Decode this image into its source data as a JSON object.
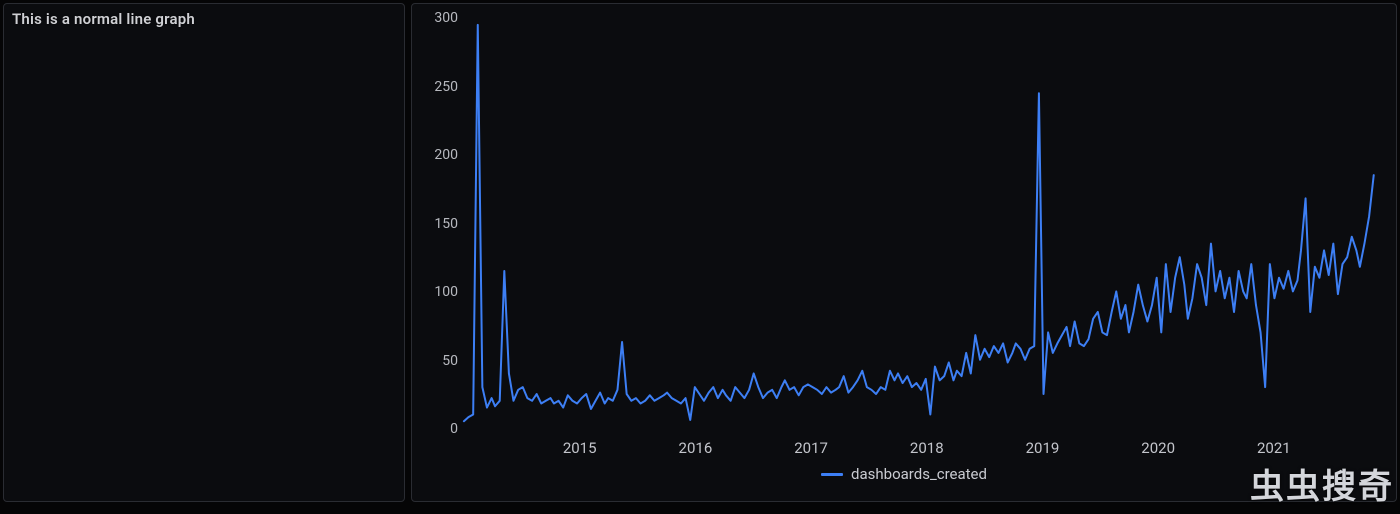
{
  "left_panel": {
    "title": "This is a normal line graph"
  },
  "watermark": "虫虫搜奇",
  "chart_data": {
    "type": "line",
    "title": "",
    "xlabel": "",
    "ylabel": "",
    "ylim": [
      0,
      300
    ],
    "yticks": [
      0,
      50,
      100,
      150,
      200,
      250,
      300
    ],
    "xlim": [
      2014.0,
      2021.9
    ],
    "xticks": [
      2015,
      2016,
      2017,
      2018,
      2019,
      2020,
      2021
    ],
    "legend_position": "bottom-center",
    "series": [
      {
        "name": "dashboards_created",
        "color": "#3d7ff5",
        "x": [
          2014.0,
          2014.04,
          2014.08,
          2014.12,
          2014.16,
          2014.2,
          2014.24,
          2014.27,
          2014.31,
          2014.35,
          2014.39,
          2014.43,
          2014.47,
          2014.51,
          2014.55,
          2014.59,
          2014.63,
          2014.67,
          2014.71,
          2014.75,
          2014.78,
          2014.82,
          2014.86,
          2014.9,
          2014.94,
          2014.98,
          2015.02,
          2015.06,
          2015.1,
          2015.14,
          2015.18,
          2015.22,
          2015.25,
          2015.29,
          2015.33,
          2015.37,
          2015.41,
          2015.45,
          2015.49,
          2015.53,
          2015.57,
          2015.61,
          2015.65,
          2015.69,
          2015.73,
          2015.76,
          2015.8,
          2015.84,
          2015.88,
          2015.92,
          2015.96,
          2016.0,
          2016.04,
          2016.08,
          2016.12,
          2016.16,
          2016.2,
          2016.24,
          2016.27,
          2016.31,
          2016.35,
          2016.39,
          2016.43,
          2016.47,
          2016.51,
          2016.55,
          2016.59,
          2016.63,
          2016.67,
          2016.71,
          2016.75,
          2016.78,
          2016.82,
          2016.86,
          2016.9,
          2016.94,
          2016.98,
          2017.02,
          2017.06,
          2017.1,
          2017.14,
          2017.18,
          2017.22,
          2017.25,
          2017.29,
          2017.33,
          2017.37,
          2017.41,
          2017.45,
          2017.49,
          2017.53,
          2017.57,
          2017.61,
          2017.65,
          2017.69,
          2017.73,
          2017.76,
          2017.8,
          2017.84,
          2017.88,
          2017.92,
          2017.96,
          2018.0,
          2018.04,
          2018.08,
          2018.12,
          2018.16,
          2018.2,
          2018.24,
          2018.27,
          2018.31,
          2018.35,
          2018.39,
          2018.43,
          2018.47,
          2018.51,
          2018.55,
          2018.59,
          2018.63,
          2018.67,
          2018.71,
          2018.75,
          2018.78,
          2018.82,
          2018.86,
          2018.9,
          2018.94,
          2018.98,
          2019.02,
          2019.06,
          2019.1,
          2019.14,
          2019.18,
          2019.22,
          2019.25,
          2019.29,
          2019.33,
          2019.37,
          2019.41,
          2019.45,
          2019.49,
          2019.53,
          2019.57,
          2019.61,
          2019.65,
          2019.69,
          2019.73,
          2019.76,
          2019.8,
          2019.84,
          2019.88,
          2019.92,
          2019.96,
          2020.0,
          2020.04,
          2020.08,
          2020.12,
          2020.16,
          2020.2,
          2020.24,
          2020.27,
          2020.31,
          2020.35,
          2020.39,
          2020.43,
          2020.47,
          2020.51,
          2020.55,
          2020.59,
          2020.63,
          2020.67,
          2020.71,
          2020.75,
          2020.78,
          2020.82,
          2020.86,
          2020.9,
          2020.94,
          2020.98,
          2021.02,
          2021.06,
          2021.1,
          2021.14,
          2021.18,
          2021.22,
          2021.25,
          2021.29,
          2021.33,
          2021.37,
          2021.41,
          2021.45,
          2021.49,
          2021.53,
          2021.57,
          2021.61,
          2021.65,
          2021.69,
          2021.73,
          2021.76,
          2021.8,
          2021.84,
          2021.88
        ],
        "values": [
          5,
          8,
          10,
          295,
          30,
          15,
          22,
          16,
          20,
          115,
          40,
          20,
          28,
          30,
          22,
          20,
          25,
          18,
          20,
          22,
          18,
          20,
          15,
          24,
          20,
          18,
          22,
          25,
          14,
          20,
          26,
          18,
          22,
          20,
          28,
          63,
          25,
          20,
          22,
          18,
          20,
          24,
          20,
          22,
          24,
          26,
          22,
          20,
          18,
          22,
          6,
          30,
          25,
          20,
          26,
          30,
          22,
          28,
          24,
          20,
          30,
          26,
          22,
          28,
          40,
          30,
          22,
          26,
          28,
          22,
          30,
          35,
          28,
          30,
          24,
          30,
          32,
          30,
          28,
          25,
          30,
          26,
          28,
          30,
          38,
          26,
          30,
          35,
          42,
          30,
          28,
          25,
          30,
          28,
          42,
          35,
          40,
          33,
          38,
          30,
          33,
          28,
          36,
          10,
          45,
          35,
          38,
          48,
          35,
          42,
          38,
          55,
          40,
          68,
          50,
          58,
          52,
          60,
          55,
          62,
          48,
          55,
          62,
          58,
          50,
          58,
          60,
          245,
          25,
          70,
          55,
          62,
          68,
          74,
          60,
          78,
          62,
          60,
          65,
          80,
          85,
          70,
          68,
          85,
          100,
          80,
          90,
          70,
          85,
          105,
          90,
          78,
          90,
          110,
          70,
          120,
          85,
          110,
          125,
          105,
          80,
          95,
          120,
          110,
          90,
          135,
          100,
          115,
          95,
          110,
          85,
          115,
          100,
          95,
          120,
          90,
          70,
          30,
          120,
          95,
          110,
          102,
          115,
          100,
          108,
          130,
          168,
          85,
          118,
          110,
          130,
          112,
          135,
          98,
          120,
          125,
          140,
          130,
          118,
          135,
          155,
          185
        ]
      }
    ]
  }
}
